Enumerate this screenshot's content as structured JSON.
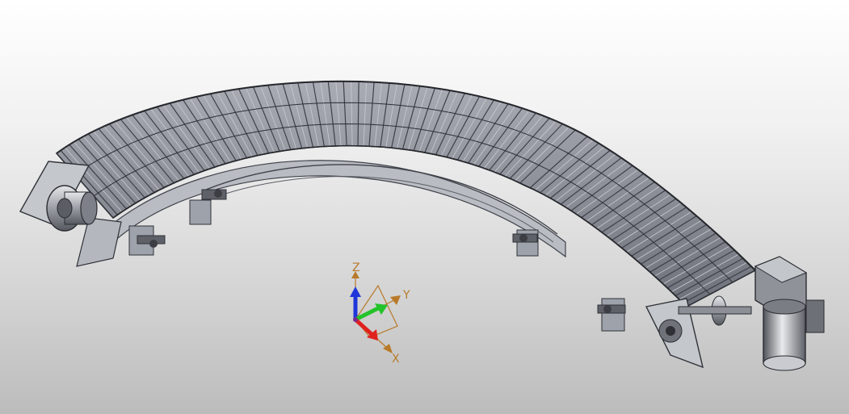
{
  "viewport": {
    "background_top": "#ffffff",
    "background_bottom": "#bcbcbc"
  },
  "model": {
    "icon": "curved-belt-conveyor-model",
    "belt_color": "#8a8d97",
    "frame_color": "#9ea2aa",
    "dark_color": "#3f424a"
  },
  "triad": {
    "x_label": "X",
    "y_label": "Y",
    "z_label": "Z",
    "x_color": "#e0221e",
    "y_color": "#24c32b",
    "z_color": "#1f37d9",
    "handle_color": "#b87a2a"
  }
}
